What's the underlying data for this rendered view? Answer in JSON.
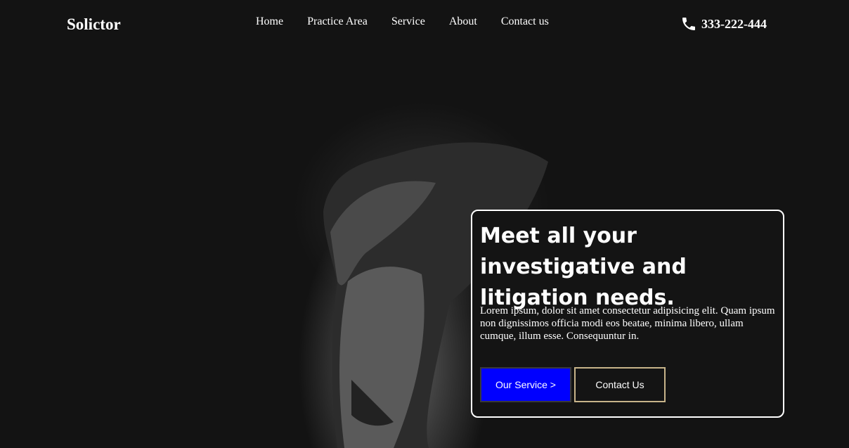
{
  "header": {
    "brand": "Solictor",
    "nav": [
      "Home",
      "Practice Area",
      "Service",
      "About",
      "Contact us"
    ],
    "phone": "333-222-444",
    "phone_icon": "phone-icon"
  },
  "hero": {
    "headline": "Meet all your investigative and litigation needs.",
    "body": "Lorem ipsum, dolor sit amet consectetur adipisicing elit. Quam ipsum non dignissimos officia modi eos beatae, minima libero, ullam cumque, illum esse. Consequuntur in.",
    "primary_button": "Our Service >",
    "secondary_button": "Contact Us"
  },
  "colors": {
    "background": "#131313",
    "primary_button": "#0000ff",
    "secondary_border": "#c8b48a",
    "text": "#ffffff"
  }
}
